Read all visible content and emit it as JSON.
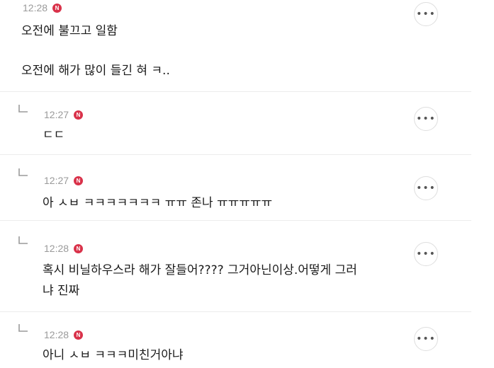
{
  "comments": [
    {
      "time": "12:28",
      "badge": "N",
      "text_line1": "오전에 불끄고 일함",
      "text_line2": "오전에 해가 많이 들긴 혀 ㅋ..",
      "more_label": "•••"
    }
  ],
  "replies": [
    {
      "time": "12:27",
      "badge": "N",
      "text": "ㄷㄷ",
      "more_label": "•••"
    },
    {
      "time": "12:27",
      "badge": "N",
      "text": "아 ㅅㅂ ㅋㅋㅋㅋㅋㅋㅋ ㅠㅠ 존나 ㅠㅠㅠㅠㅠ",
      "more_label": "•••"
    },
    {
      "time": "12:28",
      "badge": "N",
      "text_line1": "혹시 비닐하우스라 해가 잘들어???? 그거아닌이상.어떻게 그러",
      "text_line2": "냐 진짜",
      "more_label": "•••"
    },
    {
      "time": "12:28",
      "badge": "N",
      "text": "아니 ㅅㅂ ㅋㅋㅋ미친거아냐",
      "more_label": "•••"
    }
  ],
  "colors": {
    "badge": "#d9324a",
    "time": "#9a9a9a",
    "divider": "#ececec"
  },
  "icons": {
    "reply": "reply-arrow-icon",
    "more": "more-options-icon",
    "new": "new-badge-icon"
  }
}
